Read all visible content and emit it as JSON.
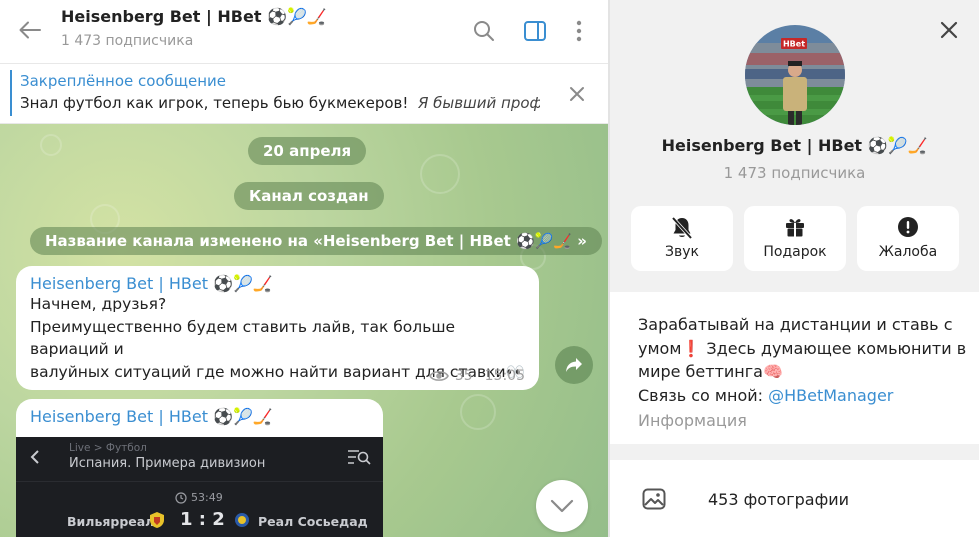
{
  "channel": {
    "title": "Heisenberg Bet | HBet ⚽🎾🏒",
    "subscribers": "1 473 подписчика"
  },
  "pinned": {
    "title": "Закреплённое сообщение",
    "text": "Знал футбол как игрок, теперь бью букмекеров!",
    "text_italic": "Я бывший проф..."
  },
  "chat": {
    "date_label": "20 апреля",
    "created_label": "Канал создан",
    "renamed_label": "Название канала изменено на «Heisenberg Bet | HBet ⚽🎾🏒 »",
    "messages": [
      {
        "author": "Heisenberg Bet | HBet ⚽🎾🏒",
        "lines": [
          "Начнем, друзья?",
          "Преимущественно будем ставить лайв, так больше вариаций и",
          "валуйных ситуаций где можно найти вариант для ставки👀"
        ],
        "views": "35",
        "time": "15:05"
      },
      {
        "author": "Heisenberg Bet | HBet ⚽🎾🏒"
      }
    ],
    "media": {
      "breadcrumb": "Live > Футбол",
      "league": "Испания. Примера дивизион",
      "match_time": "53:49",
      "home_team": "Вильярреал",
      "score": "1 : 2",
      "away_team": "Реал Сосьедад"
    }
  },
  "profile": {
    "name": "Heisenberg Bet | HBet ⚽🎾🏒",
    "subscribers": "1 473 подписчика",
    "actions": [
      {
        "label": "Звук",
        "icon": "bell-off-icon"
      },
      {
        "label": "Подарок",
        "icon": "gift-icon"
      },
      {
        "label": "Жалоба",
        "icon": "warning-icon"
      }
    ],
    "description": {
      "line1": "Зарабатывай на дистанции и ставь с",
      "line2": "умом❗ Здесь думающее комьюнити в",
      "line3": "мире беттинга🧠",
      "contact_prefix": "Связь со мной: ",
      "contact_link": "@HBetManager"
    },
    "info_label": "Информация",
    "photos_label": "453 фотографии"
  },
  "avatar_badge": "HBet",
  "colors": {
    "accent": "#3a8ed1",
    "chat_bg": "#b5d39b",
    "right_bg": "#f1f1f1"
  }
}
